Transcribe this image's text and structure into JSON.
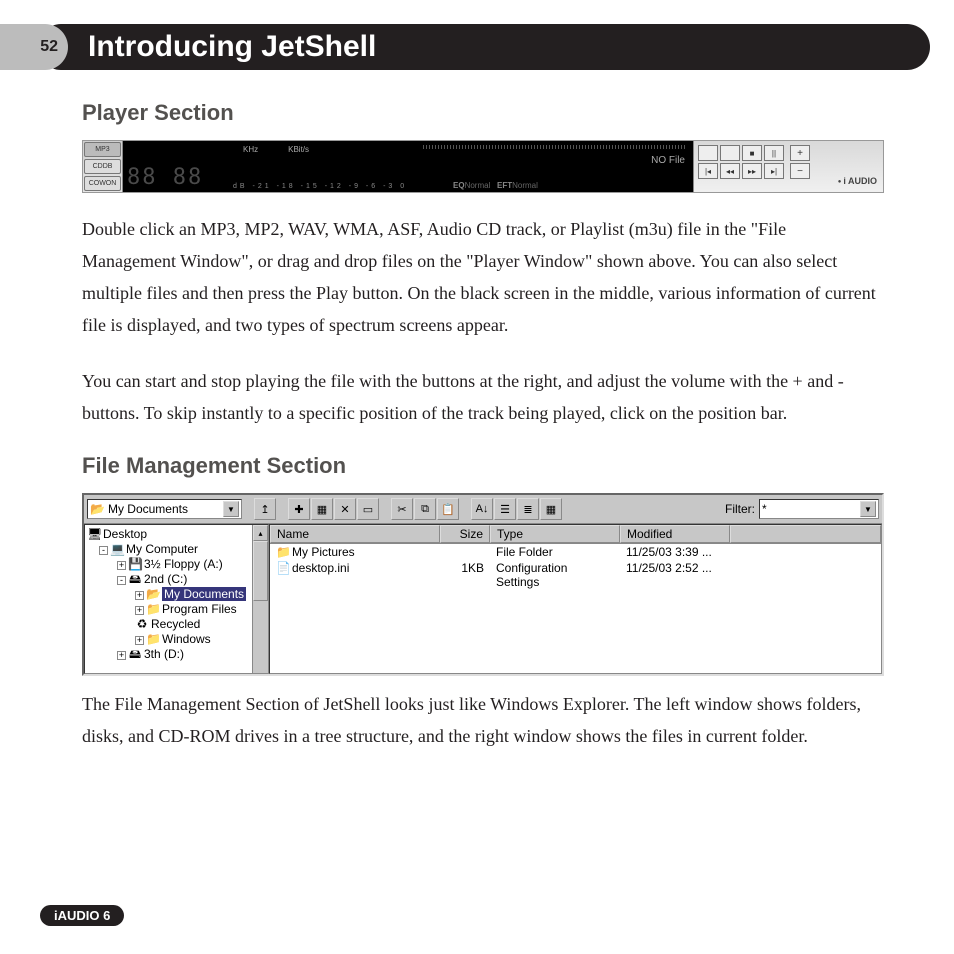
{
  "page_number": "52",
  "page_title": "Introducing JetShell",
  "footer": "iAUDIO 6",
  "section1": {
    "heading": "Player Section",
    "para1": "Double click an MP3, MP2, WAV, WMA, ASF, Audio CD track, or Playlist (m3u) file in the \"File Management Window\", or drag and drop files on the \"Player Window\" shown above. You can also select multiple files and then press the Play button. On the black screen in the middle, various information of current file is displayed, and two types of spectrum screens appear.",
    "para2": "You can start and stop playing the file with the buttons at the right, and adjust the volume with the + and - buttons. To skip instantly to a specific position of the track being played, click on the position bar."
  },
  "section2": {
    "heading": "File Management Section",
    "para1": "The File Management Section of JetShell looks just like Windows Explorer. The left window shows folders, disks, and CD-ROM drives in a tree structure, and the right window shows the files in current folder."
  },
  "player": {
    "src_mp3": "MP3",
    "src_cddb": "CDDB",
    "brand": "COWON",
    "digits": "88 88",
    "khz": "KHz",
    "kbits": "KBit/s",
    "scale": "dB -21 -18 -15 -12  -9  -6  -3  0",
    "eq_label": "EQ",
    "eq_val": "Normal",
    "eft_label": "EFT",
    "eft_val": "Normal",
    "file_status": "NO File",
    "btn_prev_track": "|◂",
    "btn_rew": "◂◂",
    "btn_stop": "■",
    "btn_play": "▸▸",
    "btn_ff": "▸|",
    "btn_next_track": "▸|",
    "btn_pause": "||",
    "btn_spacer": "",
    "vol_plus": "+",
    "vol_minus": "−",
    "logo": "i AUDIO"
  },
  "filemgr": {
    "path_combo": "My Documents",
    "filter_label": "Filter:",
    "filter_value": "*",
    "toolbar": {
      "up": "↥",
      "new": "✚",
      "props": "▦",
      "delete": "✕",
      "folder": "▭",
      "cut": "✂",
      "copy": "⧉",
      "paste": "📋",
      "sort": "A↓",
      "view_list": "☰",
      "view_detail": "≣",
      "view_icons": "▦"
    },
    "tree": [
      {
        "ind": 0,
        "exp": "",
        "ico": "🖥",
        "label": "Desktop"
      },
      {
        "ind": 1,
        "exp": "-",
        "ico": "💻",
        "label": "My Computer"
      },
      {
        "ind": 2,
        "exp": "+",
        "ico": "💾",
        "label": "3½ Floppy (A:)"
      },
      {
        "ind": 2,
        "exp": "-",
        "ico": "🖴",
        "label": "2nd (C:)"
      },
      {
        "ind": 3,
        "exp": "+",
        "ico": "📂",
        "label": "My Documents",
        "selected": true
      },
      {
        "ind": 3,
        "exp": "+",
        "ico": "📁",
        "label": "Program Files"
      },
      {
        "ind": 3,
        "exp": "",
        "ico": "♻",
        "label": "Recycled"
      },
      {
        "ind": 3,
        "exp": "+",
        "ico": "📁",
        "label": "Windows"
      },
      {
        "ind": 2,
        "exp": "+",
        "ico": "🖴",
        "label": "3th (D:)"
      }
    ],
    "columns": {
      "name": "Name",
      "size": "Size",
      "type": "Type",
      "modified": "Modified"
    },
    "rows": [
      {
        "ico": "📁",
        "name": "My Pictures",
        "size": "",
        "type": "File Folder",
        "modified": "11/25/03 3:39 ..."
      },
      {
        "ico": "📄",
        "name": "desktop.ini",
        "size": "1KB",
        "type": "Configuration Settings",
        "modified": "11/25/03 2:52 ..."
      }
    ]
  }
}
